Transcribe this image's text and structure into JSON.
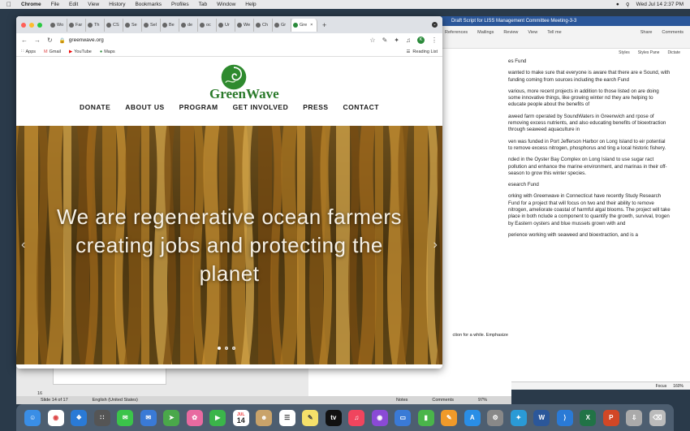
{
  "menubar": {
    "apple": "",
    "app": "Chrome",
    "items": [
      "File",
      "Edit",
      "View",
      "History",
      "Bookmarks",
      "Profiles",
      "Tab",
      "Window",
      "Help"
    ],
    "clock": "Wed Jul 14  2:37 PM"
  },
  "word": {
    "title": "Draft Script for LISS Management Committee Meeting-3-3",
    "tabs": [
      "References",
      "Mailings",
      "Review",
      "View",
      "Tell me"
    ],
    "actions": [
      "Share",
      "Comments"
    ],
    "tools": [
      "Styles",
      "Styles Pane",
      "Dictate"
    ],
    "paragraphs": [
      "es Fund",
      "wanted to make sure that everyone is aware that there are e Sound, with funding coming from sources including the earch Fund",
      "various, more recent projects in addition to those listed on are doing some innovative things, like growing winter nd they are helping to educate people about the benefits of",
      "aweed farm operated by SoundWaters in Greenwich and rpose of removing excess nutrients, and also educating benefits of bioextraction through seaweed aquaculture in",
      "ven was funded in Port Jefferson Harbor on Long Island to eir potential to remove excess nitrogen, phosphorus and ting a local historic fishery.",
      "nded in the Oyster Bay Complex on Long Island to use sugar ract pollution and enhance the marine environment, and marinas in their off-season to grow this winter species.",
      "esearch Fund",
      "orking with Greenwave in Connecticut have recently Study Research Fund for a project that will focus on two and their ability to remove nitrogen, ameliorate coastal of harmful algal blooms.  The project will take place in both nclude a component to quantify the growth, survival, trogen by Eastern oysters and blue mussels grown with and",
      "perience working with seaweed and bioextraction, and is a"
    ],
    "status": [
      "Focus",
      "160%"
    ]
  },
  "ppt": {
    "slide_info": "Slide 14 of 17",
    "language": "English (United States)",
    "notes": "Notes",
    "comments": "Comments",
    "zoom": "97%",
    "slide_num": "16",
    "sidebar_text": "ction for a while.  Emphasize"
  },
  "chrome": {
    "tabs": [
      "Wo",
      "Far",
      "Th",
      "CS",
      "Se",
      "Sel",
      "Be",
      "de",
      "oc",
      "Ur",
      "We",
      "Ch",
      "Gr",
      "Gre"
    ],
    "url": "greenwave.org",
    "profile_initial": "K",
    "bookmarks": [
      "Apps",
      "Gmail",
      "YouTube",
      "Maps"
    ],
    "reading_list": "Reading List"
  },
  "site": {
    "logo_text": "GreenWave",
    "nav": [
      "DONATE",
      "ABOUT US",
      "PROGRAM",
      "GET INVOLVED",
      "PRESS",
      "CONTACT"
    ],
    "hero_text": "We are regenerative ocean farmers creating jobs and protecting the planet",
    "slides": {
      "count": 3,
      "current": 1
    }
  },
  "dock": {
    "calendar_month": "JUL",
    "calendar_day": "14"
  },
  "colors": {
    "brand_green": "#2a7a2a",
    "word_blue": "#2b579a"
  }
}
